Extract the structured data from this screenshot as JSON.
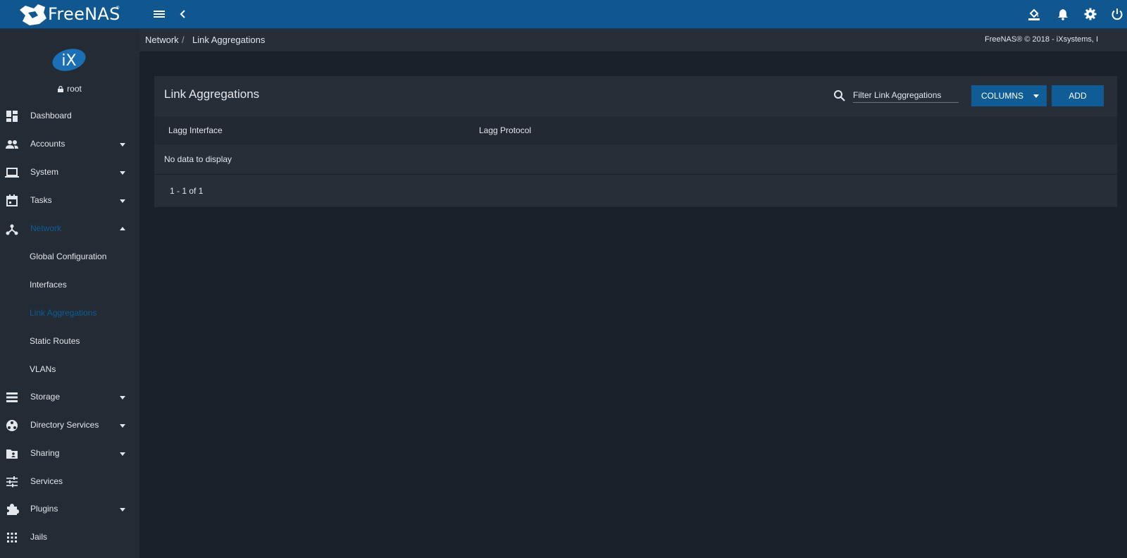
{
  "topbar": {
    "brand": "FreeNAS",
    "trademark": "®",
    "icons": [
      "menu-icon",
      "collapse-chevron-icon",
      "theme-paint-bucket-icon",
      "notifications-bell-icon",
      "settings-gear-icon",
      "power-icon"
    ]
  },
  "user": {
    "logo": "iX",
    "name": "root"
  },
  "sidebar": {
    "items": [
      {
        "label": "Dashboard",
        "icon": "dashboard-icon"
      },
      {
        "label": "Accounts",
        "icon": "people-icon"
      },
      {
        "label": "System",
        "icon": "laptop-icon"
      },
      {
        "label": "Tasks",
        "icon": "calendar-icon"
      },
      {
        "label": "Network",
        "icon": "network-icon"
      },
      {
        "label": "Storage",
        "icon": "storage-icon"
      },
      {
        "label": "Directory Services",
        "icon": "directory-icon"
      },
      {
        "label": "Sharing",
        "icon": "folder-share-icon"
      },
      {
        "label": "Services",
        "icon": "tune-icon"
      },
      {
        "label": "Plugins",
        "icon": "puzzle-icon"
      },
      {
        "label": "Jails",
        "icon": "apps-grid-icon"
      }
    ],
    "network_sub": [
      {
        "label": "Global Configuration"
      },
      {
        "label": "Interfaces"
      },
      {
        "label": "Link Aggregations"
      },
      {
        "label": "Static Routes"
      },
      {
        "label": "VLANs"
      }
    ],
    "accent_color": "#0f5c97"
  },
  "breadcrumb": {
    "parent": "Network",
    "separator": "/",
    "current": "Link Aggregations"
  },
  "copyright": "FreeNAS® © 2018 - iXsystems, I",
  "card": {
    "title": "Link Aggregations",
    "filter_placeholder": "Filter Link Aggregations",
    "columns_button": "COLUMNS",
    "add_button": "ADD",
    "columns": [
      "Lagg Interface",
      "Lagg Protocol"
    ],
    "empty_text": "No data to display",
    "pager": "1 - 1 of 1"
  }
}
